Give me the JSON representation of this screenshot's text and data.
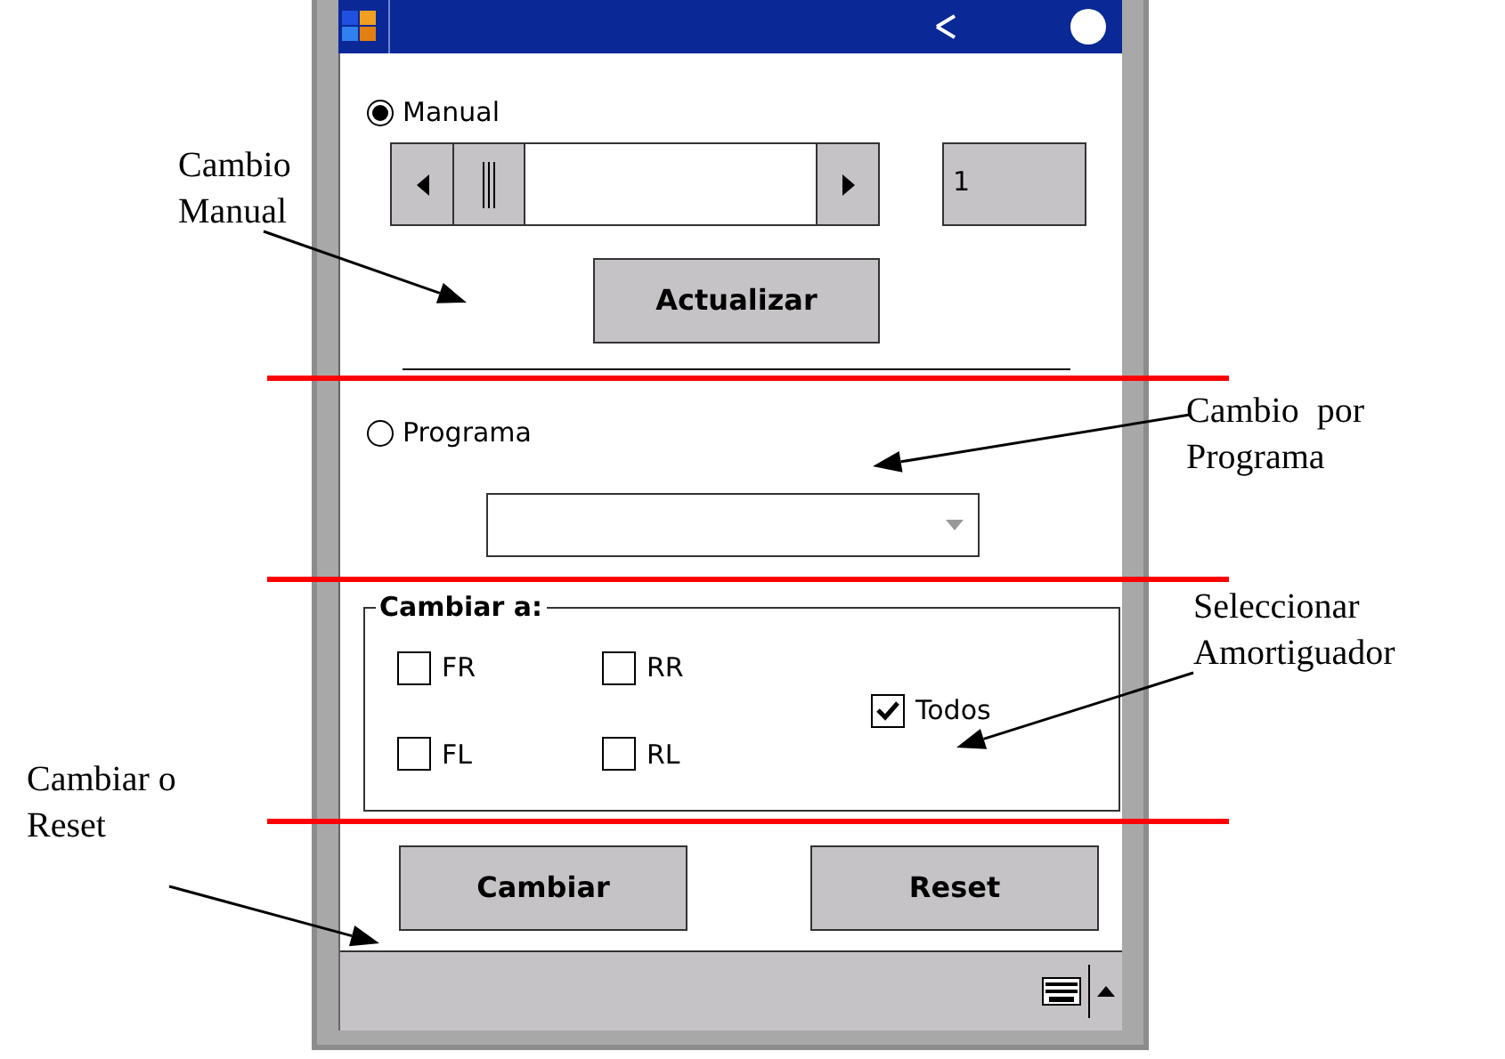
{
  "annotations": [
    {
      "lines": [
        "Cambio",
        "Manual"
      ]
    },
    {
      "lines": [
        "Cambio  por",
        "Programa"
      ]
    },
    {
      "lines": [
        "Seleccionar",
        "Amortiguador"
      ]
    },
    {
      "lines": [
        "Cambiar o",
        "Reset"
      ]
    }
  ],
  "manual": {
    "label": "Manual",
    "selected": true
  },
  "value_field": {
    "value": "1"
  },
  "update_button": "Actualizar",
  "program": {
    "label": "Programa",
    "selected": false
  },
  "group": {
    "title": "Cambiar a:",
    "checkboxes": [
      {
        "label": "FR",
        "checked": false
      },
      {
        "label": "RR",
        "checked": false
      },
      {
        "label": "FL",
        "checked": false
      },
      {
        "label": "RL",
        "checked": false
      },
      {
        "label": "Todos",
        "checked": true
      }
    ]
  },
  "buttons": [
    "Cambiar",
    "Reset"
  ]
}
